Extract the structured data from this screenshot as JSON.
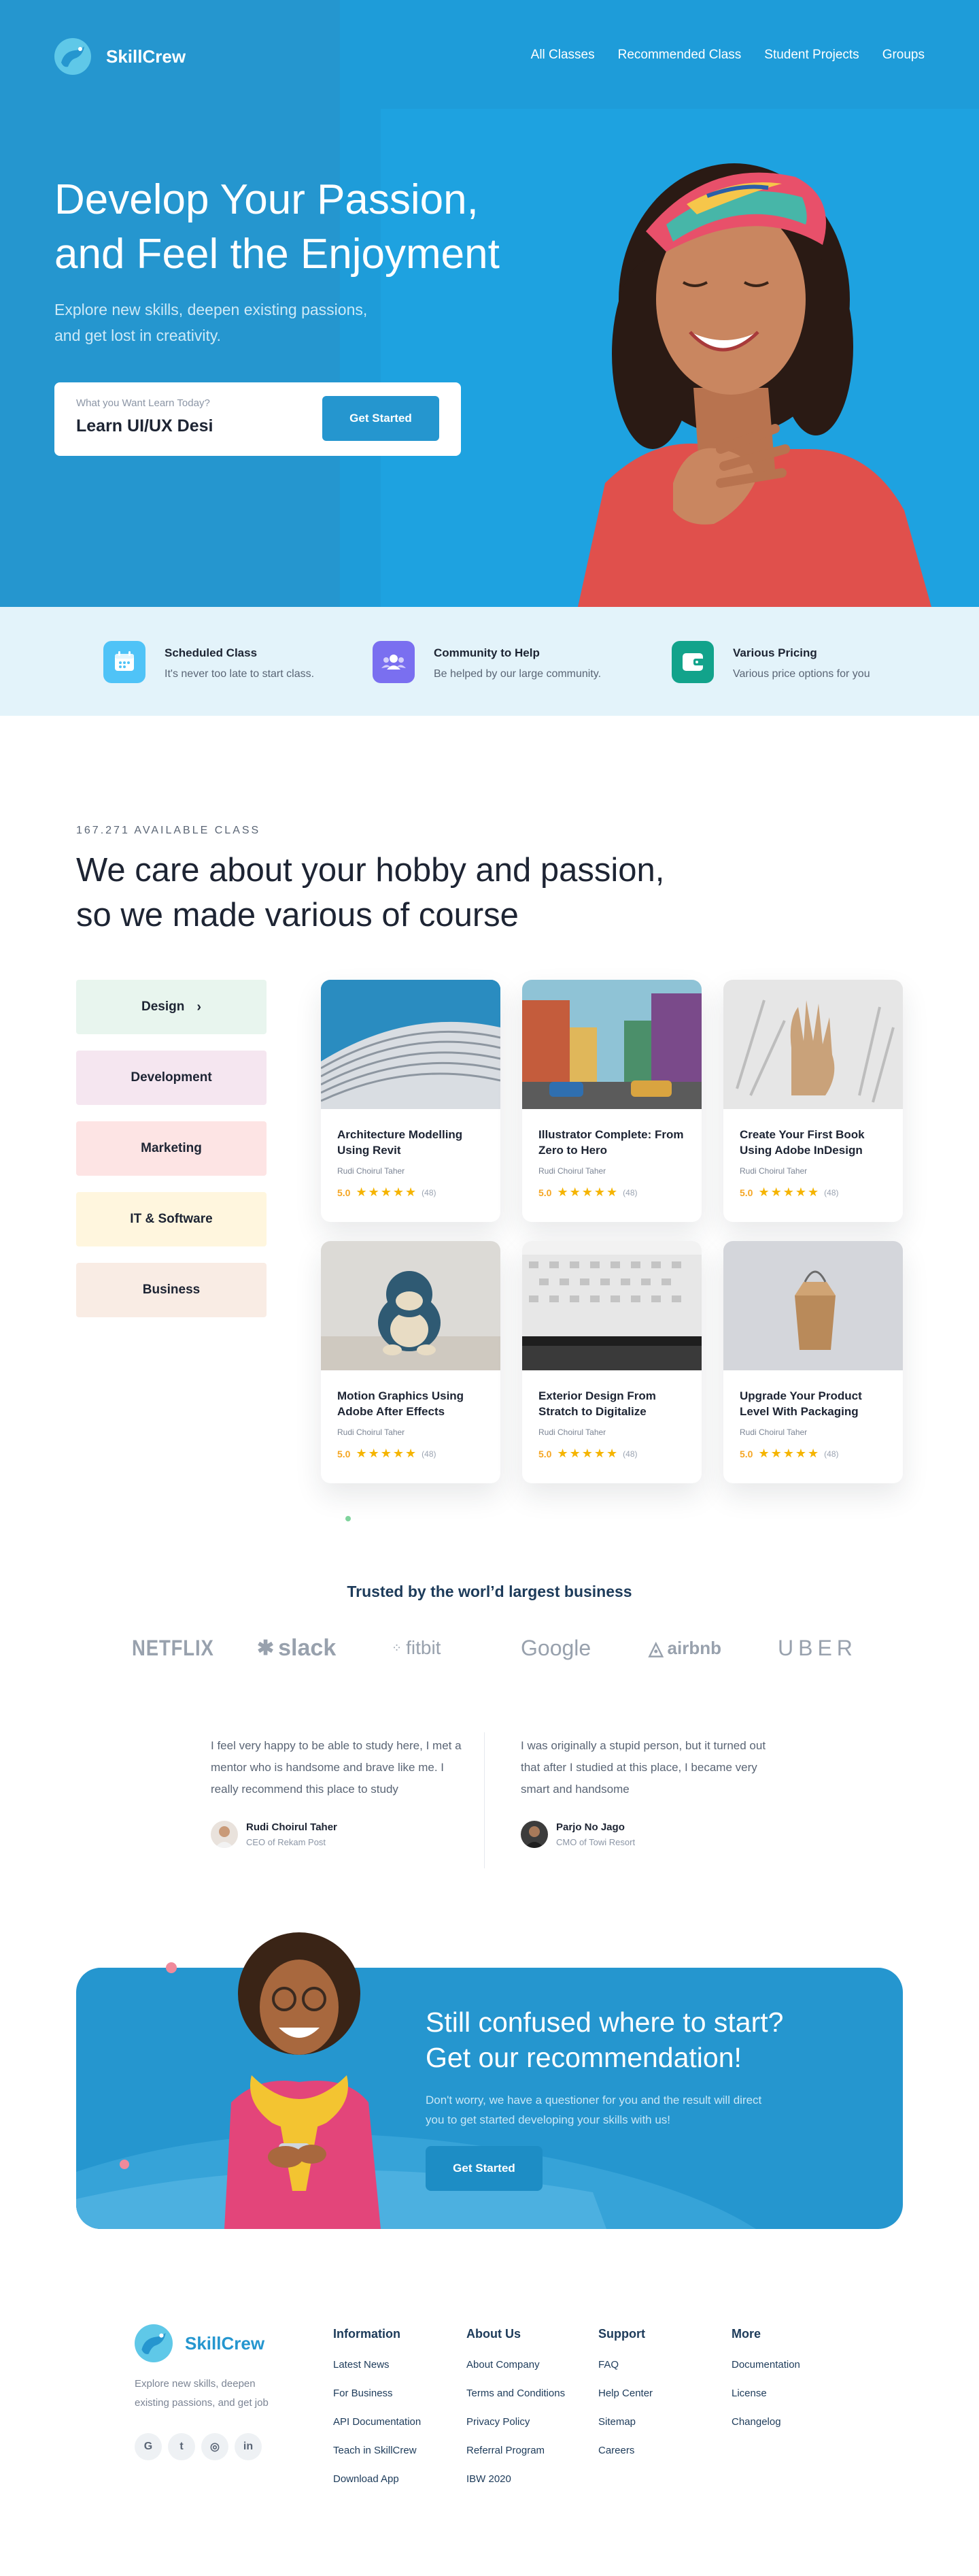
{
  "brand": {
    "name": "SkillCrew",
    "primary_color": "#2596cf",
    "accent_light": "#e3f3fa"
  },
  "nav": {
    "links": [
      "All Classes",
      "Recommended Class",
      "Student Projects",
      "Groups"
    ]
  },
  "hero": {
    "title_line1": "Develop Your Passion,",
    "title_line2": "and Feel the Enjoyment",
    "subtitle_line1": "Explore new skills, deepen existing passions,",
    "subtitle_line2": "and get lost in creativity.",
    "search": {
      "label": "What you Want Learn Today?",
      "value": "Learn UI/UX Desi",
      "button": "Get Started"
    }
  },
  "features": [
    {
      "title": "Scheduled Class",
      "desc": "It's never too late to start class.",
      "icon": "calendar-icon",
      "color": "#4fc3f7"
    },
    {
      "title": "Community to Help",
      "desc": "Be helped by our large community.",
      "icon": "community-icon",
      "color": "#7a6ff0"
    },
    {
      "title": "Various Pricing",
      "desc": "Various price options for you",
      "icon": "wallet-icon",
      "color": "#12a38b"
    }
  ],
  "courses_section": {
    "count_label": "167.271 AVAILABLE CLASS",
    "title_line1": "We care about your hobby and passion,",
    "title_line2": "so we made various of course",
    "categories": [
      {
        "label": "Design",
        "color": "#e8f5ee",
        "active": true
      },
      {
        "label": "Development",
        "color": "#f5e6f0"
      },
      {
        "label": "Marketing",
        "color": "#fde4e4"
      },
      {
        "label": "IT & Software",
        "color": "#fff6de"
      },
      {
        "label": "Business",
        "color": "#f9ece4"
      }
    ],
    "courses": [
      {
        "title": "Architecture Modelling Using Revit",
        "author": "Rudi Choirul Taher",
        "score": "5.0",
        "stars": "★★★★★",
        "reviews": "(48)",
        "image": "architecture-photo"
      },
      {
        "title": "Illustrator Complete: From Zero to Hero",
        "author": "Rudi Choirul Taher",
        "score": "5.0",
        "stars": "★★★★★",
        "reviews": "(48)",
        "image": "street-illustration"
      },
      {
        "title": "Create Your First Book Using Adobe InDesign",
        "author": "Rudi Choirul Taher",
        "score": "5.0",
        "stars": "★★★★★",
        "reviews": "(48)",
        "image": "hand-sketch-photo"
      },
      {
        "title": "Motion Graphics Using Adobe After Effects",
        "author": "Rudi Choirul Taher",
        "score": "5.0",
        "stars": "★★★★★",
        "reviews": "(48)",
        "image": "toy-figure-photo"
      },
      {
        "title": "Exterior Design From Stratch to Digitalize",
        "author": "Rudi Choirul Taher",
        "score": "5.0",
        "stars": "★★★★★",
        "reviews": "(48)",
        "image": "building-photo"
      },
      {
        "title": "Upgrade Your Product Level With Packaging",
        "author": "Rudi Choirul Taher",
        "score": "5.0",
        "stars": "★★★★★",
        "reviews": "(48)",
        "image": "box-photo"
      }
    ]
  },
  "trusted": {
    "title": "Trusted by the worl’d largest business",
    "brands": [
      "NETFLIX",
      "slack",
      "fitbit",
      "Google",
      "airbnb",
      "UBER"
    ]
  },
  "testimonials": [
    {
      "quote": "I feel very happy to be able to study here, I met a mentor who is handsome and brave like me. I really recommend this place to study",
      "name": "Rudi Choirul Taher",
      "role": "CEO of Rekam Post"
    },
    {
      "quote": "I was originally a stupid person, but it turned out that after I studied at this place, I became very smart and handsome",
      "name": "Parjo No Jago",
      "role": "CMO of Towi Resort"
    }
  ],
  "cta": {
    "title_line1": "Still confused where to start?",
    "title_line2": "Get our recommendation!",
    "subtitle": "Don't worry, we have a questioner for you and the result will direct you to get started developing your skills with us!",
    "button": "Get Started"
  },
  "footer": {
    "about": "Explore new skills, deepen existing passions, and get job",
    "socials": [
      "G",
      "t",
      "◎",
      "in"
    ],
    "columns": [
      {
        "title": "Information",
        "links": [
          "Latest News",
          "For Business",
          "API Documentation",
          "Teach in SkillCrew",
          "Download App"
        ]
      },
      {
        "title": "About Us",
        "links": [
          "About Company",
          "Terms and Conditions",
          "Privacy Policy",
          "Referral Program",
          "IBW 2020"
        ]
      },
      {
        "title": "Support",
        "links": [
          "FAQ",
          "Help Center",
          "Sitemap",
          "Careers"
        ]
      },
      {
        "title": "More",
        "links": [
          "Documentation",
          "License",
          "Changelog"
        ]
      }
    ]
  }
}
